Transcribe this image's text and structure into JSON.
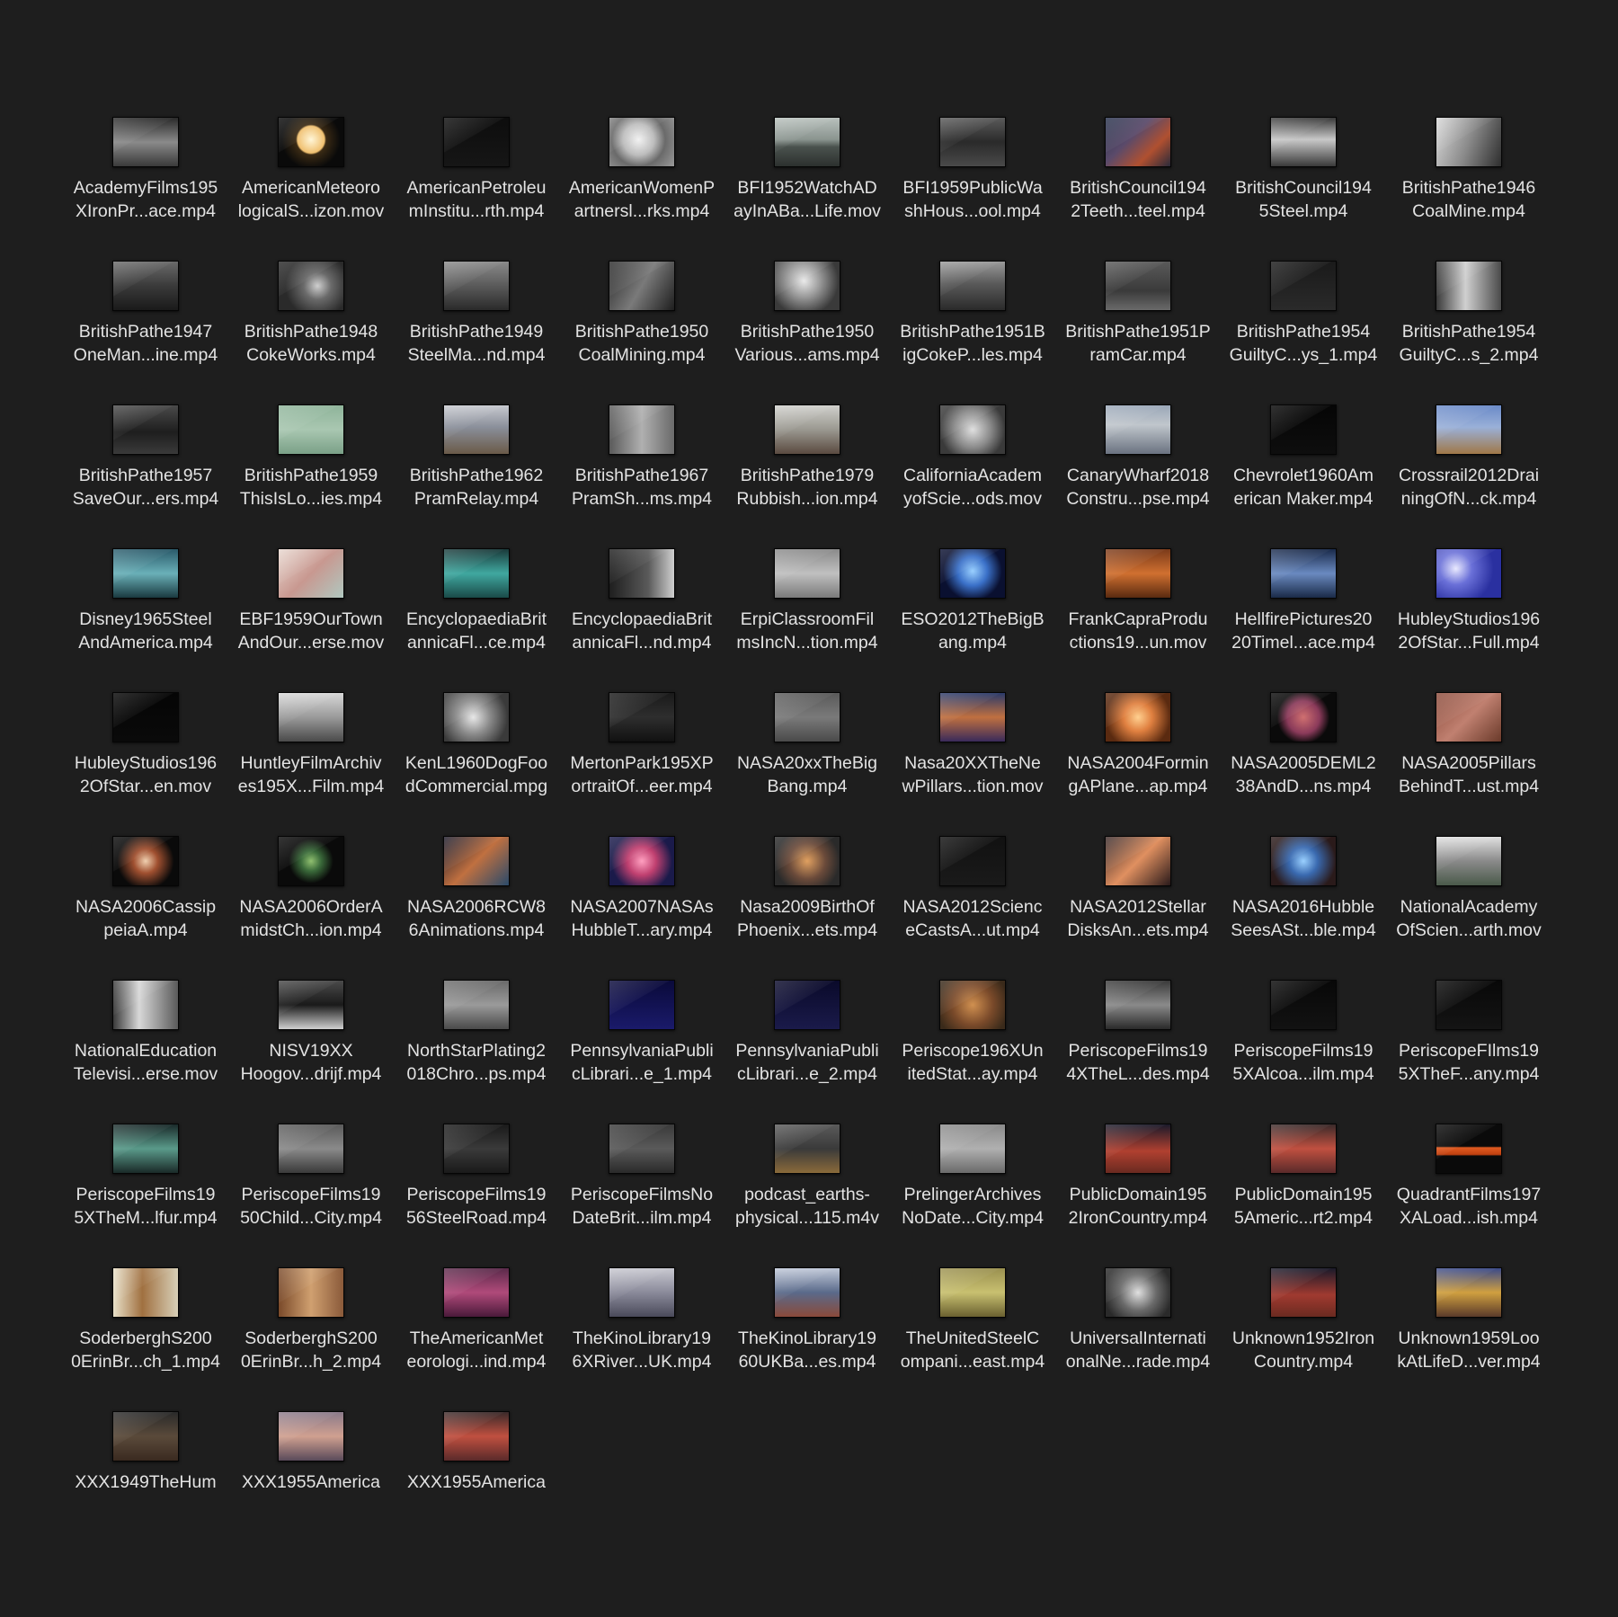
{
  "files": [
    {
      "line1": "AcademyFilms195",
      "line2": "XIronPr...ace.mp4",
      "thumb": "linear-gradient(#2a2a2a,#8a8a8a 50%,#3a3a3a)"
    },
    {
      "line1": "AmericanMeteoro",
      "line2": "logicalS...izon.mov",
      "thumb": "radial-gradient(circle at 50% 45%, #fff6d8 0%, #f0c070 32%, #3a2a14 36%, #0a0a0a 70%)"
    },
    {
      "line1": "AmericanPetroleu",
      "line2": "mInstitu...rth.mp4",
      "thumb": "linear-gradient(#0d0d0d,#161616)"
    },
    {
      "line1": "AmericanWomenP",
      "line2": "artnersl...rks.mp4",
      "thumb": "radial-gradient(circle at 45% 45%, #f2f2f2 0%, #bdbdbd 35%, #6a6a6a 60%, #9a9a9a 100%)"
    },
    {
      "line1": "BFI1952WatchAD",
      "line2": "ayInABa...Life.mov",
      "thumb": "linear-gradient(#b9c1bd 0%, #8a948f 45%, #4a524e 60%, #2c302e 100%)"
    },
    {
      "line1": "BFI1959PublicWa",
      "line2": "shHous...ool.mp4",
      "thumb": "linear-gradient(#5a5a5a,#2a2a2a 50%,#4a4a4a)"
    },
    {
      "line1": "BritishCouncil194",
      "line2": "2Teeth...teel.mp4",
      "thumb": "linear-gradient(135deg,#25304a 0%, #5a4a6a 40%, #b05030 70%, #2a2a3a 100%)"
    },
    {
      "line1": "BritishCouncil194",
      "line2": "5Steel.mp4",
      "thumb": "linear-gradient(#3a3a3a,#c8c8c8 45%,#3a3a3a)"
    },
    {
      "line1": "BritishPathe1946",
      "line2": "CoalMine.mp4",
      "thumb": "linear-gradient(110deg,#d8d8d8,#8a8a8a 50%,#2e2e2e)"
    },
    {
      "line1": "BritishPathe1947",
      "line2": "OneMan...ine.mp4",
      "thumb": "linear-gradient(#6a6a6a,#3a3a3a 50%,#1a1a1a)"
    },
    {
      "line1": "BritishPathe1948",
      "line2": "CokeWorks.mp4",
      "thumb": "radial-gradient(circle at 60% 50%, #cfcfcf 0%, #6a6a6a 30%, #2a2a2a 70%)"
    },
    {
      "line1": "BritishPathe1949",
      "line2": "SteelMa...nd.mp4",
      "thumb": "linear-gradient(#8a8a8a,#5a5a5a 50%,#2a2a2a)"
    },
    {
      "line1": "BritishPathe1950",
      "line2": "CoalMining.mp4",
      "thumb": "linear-gradient(120deg,#2a2a2a,#7a7a7a 50%,#1e1e1e)"
    },
    {
      "line1": "BritishPathe1950",
      "line2": "Various...ams.mp4",
      "thumb": "radial-gradient(circle at 45% 40%, #eaeaea 0%, #9a9a9a 35%, #3a3a3a 75%)"
    },
    {
      "line1": "BritishPathe1951B",
      "line2": "igCokeP...les.mp4",
      "thumb": "linear-gradient(#9a9a9a,#5a5a5a 45%,#2a2a2a)"
    },
    {
      "line1": "BritishPathe1951P",
      "line2": "ramCar.mp4",
      "thumb": "linear-gradient(#5a5a5a,#3a3a3a 60%,#6a6a6a)"
    },
    {
      "line1": "BritishPathe1954",
      "line2": "GuiltyC...ys_1.mp4",
      "thumb": "linear-gradient(#1a1a1a,#2a2a2a)"
    },
    {
      "line1": "BritishPathe1954",
      "line2": "GuiltyC...s_2.mp4",
      "thumb": "linear-gradient(90deg,#3a3a3a,#d0d0d0 45%,#4a4a4a)"
    },
    {
      "line1": "BritishPathe1957",
      "line2": "SaveOur...ers.mp4",
      "thumb": "linear-gradient(#4a4a4a,#1e1e1e 55%,#3a3a3a)"
    },
    {
      "line1": "BritishPathe1959",
      "line2": "ThisIsLo...ies.mp4",
      "thumb": "linear-gradient(#8fb49a,#a9c7b1 50%,#7aa087)"
    },
    {
      "line1": "BritishPathe1962",
      "line2": "PramRelay.mp4",
      "thumb": "linear-gradient(#c7c9cf,#8a8f9a 45%,#6a5a48)"
    },
    {
      "line1": "BritishPathe1967",
      "line2": "PramSh...ms.mp4",
      "thumb": "linear-gradient(90deg,#5a5a5a,#b0b0b0 50%,#6a6a6a)"
    },
    {
      "line1": "BritishPathe1979",
      "line2": "Rubbish...ion.mp4",
      "thumb": "linear-gradient(#d0d0cc,#9a9890 50%,#5a4a40)"
    },
    {
      "line1": "CaliforniaAcadem",
      "line2": "yofScie...ods.mov",
      "thumb": "radial-gradient(circle at 50% 50%, #e0e0e0 0%, #8a8a8a 45%, #3a3a3a 80%)"
    },
    {
      "line1": "CanaryWharf2018",
      "line2": "Constru...pse.mp4",
      "thumb": "linear-gradient(#9aa7b8,#c0c6cc 40%,#6a7280)"
    },
    {
      "line1": "Chevrolet1960Am",
      "line2": "erican Maker.mp4",
      "thumb": "linear-gradient(#050505,#0e0e0e)"
    },
    {
      "line1": "Crossrail2012Drai",
      "line2": "ningOfN...ck.mp4",
      "thumb": "linear-gradient(#6a8ac8,#9ab0d8 45%,#a07848)"
    },
    {
      "line1": "Disney1965Steel",
      "line2": "AndAmerica.mp4",
      "thumb": "linear-gradient(#2a5a6a,#6ab0b8 50%,#1a3a40)"
    },
    {
      "line1": "EBF1959OurTown",
      "line2": "AndOur...erse.mov",
      "thumb": "linear-gradient(135deg,#e8d8d0,#c89890 50%,#b0c8c0)"
    },
    {
      "line1": "EncyclopaediaBrit",
      "line2": "annicaFl...ce.mp4",
      "thumb": "linear-gradient(#1a3a3a,#40a8a0 50%,#1a4a48)"
    },
    {
      "line1": "EncyclopaediaBrit",
      "line2": "annicaFl...nd.mp4",
      "thumb": "linear-gradient(90deg,#1e1e1e,#5a5a5a 60%,#cfcfcf)"
    },
    {
      "line1": "ErpiClassroomFil",
      "line2": "msIncN...tion.mp4",
      "thumb": "linear-gradient(#8a8a8a,#c0c0c0 50%,#7a7a7a)"
    },
    {
      "line1": "ESO2012TheBigB",
      "line2": "ang.mp4",
      "thumb": "radial-gradient(circle at 50% 45%, #9ad0ff 0%, #3a70c8 35%, #0a1030 70%)"
    },
    {
      "line1": "FrankCapraProdu",
      "line2": "ctions19...un.mov",
      "thumb": "linear-gradient(#7a3a1a,#d07030 50%,#5a2a10)"
    },
    {
      "line1": "HellfirePictures20",
      "line2": "20Timel...ace.mp4",
      "thumb": "linear-gradient(#1a2a4a,#6a8ac0 50%,#1a2a48)"
    },
    {
      "line1": "HubleyStudios196",
      "line2": "2OfStar...Full.mp4",
      "thumb": "radial-gradient(circle at 30% 40%, #e8e8ff 0%, #6a70d8 30%, #2a30a0 70%)"
    },
    {
      "line1": "HubleyStudios196",
      "line2": "2OfStar...en.mov",
      "thumb": "linear-gradient(#050505,#0a0a0a)"
    },
    {
      "line1": "HuntleyFilmArchiv",
      "line2": "es195X...Film.mp4",
      "thumb": "linear-gradient(#d8d8d8,#9a9a9a 50%,#4a4a4a)"
    },
    {
      "line1": "KenL1960DogFoo",
      "line2": "dCommercial.mpg",
      "thumb": "radial-gradient(circle at 45% 50%, #e8e8e8 0%, #8a8a8a 40%, #3a3a3a 80%)"
    },
    {
      "line1": "MertonPark195XP",
      "line2": "ortraitOf...eer.mp4",
      "thumb": "linear-gradient(#1a1a1a,#2e2e2e 50%,#111)"
    },
    {
      "line1": "NASA20xxTheBig",
      "line2": "Bang.mp4",
      "thumb": "linear-gradient(#5a5a5a,#7a7a7a 50%,#4a4a4a)"
    },
    {
      "line1": "Nasa20XXTheNe",
      "line2": "wPillars...tion.mov",
      "thumb": "linear-gradient(#2a3a6a,#c07040 50%,#3a2a5a)"
    },
    {
      "line1": "NASA2004Formin",
      "line2": "gAPlane...ap.mp4",
      "thumb": "radial-gradient(circle at 50% 50%, #ffd090 0%, #e08040 35%, #5a2a10 80%)"
    },
    {
      "line1": "NASA2005DEML2",
      "line2": "38AndD...ns.mp4",
      "thumb": "radial-gradient(circle at 50% 50%, #d07070 0%, #8a3a5a 40%, #0a0a0a 65%)"
    },
    {
      "line1": "NASA2005Pillars",
      "line2": "BehindT...ust.mp4",
      "thumb": "linear-gradient(135deg,#8a4a3a,#c08070 50%,#6a3a2a)"
    },
    {
      "line1": "NASA2006Cassip",
      "line2": "peiaA.mp4",
      "thumb": "radial-gradient(circle at 50% 50%, #f0d0b0 0%, #a05030 30%, #0a0a0a 70%)"
    },
    {
      "line1": "NASA2006OrderA",
      "line2": "midstCh...ion.mp4",
      "thumb": "radial-gradient(circle at 50% 50%, #90c070 0%, #3a6a3a 25%, #0a0a0a 55%)"
    },
    {
      "line1": "NASA2006RCW8",
      "line2": "6Animations.mp4",
      "thumb": "linear-gradient(135deg,#1a1a2a,#c07040 50%,#2a4a6a)"
    },
    {
      "line1": "NASA2007NASAs",
      "line2": "HubbleT...ary.mp4",
      "thumb": "radial-gradient(circle at 50% 50%, #ffa0c0 0%, #c04070 35%, #1a1a4a 75%)"
    },
    {
      "line1": "Nasa2009BirthOf",
      "line2": "Phoenix...ets.mp4",
      "thumb": "radial-gradient(circle at 50% 50%, #e0a060 0%, #6a4a3a 45%, #2a2a2a 80%)"
    },
    {
      "line1": "NASA2012Scienc",
      "line2": "eCastsA...ut.mp4",
      "thumb": "linear-gradient(#111,#1a1a1a)"
    },
    {
      "line1": "NASA2012Stellar",
      "line2": "DisksAn...ets.mp4",
      "thumb": "linear-gradient(135deg,#3a2a2a,#e09060 50%,#2a1a1a)"
    },
    {
      "line1": "NASA2016Hubble",
      "line2": "SeesASt...ble.mp4",
      "thumb": "radial-gradient(circle at 50% 50%, #9ad0ff 0%, #3a6ab0 35%, #2a1a1a 80%)"
    },
    {
      "line1": "NationalAcademy",
      "line2": "OfScien...arth.mov",
      "thumb": "linear-gradient(#e0e0e0,#8a8a8a 50%,#4a5a4a)"
    },
    {
      "line1": "NationalEducation",
      "line2": "Televisi...erse.mov",
      "thumb": "linear-gradient(90deg,#3a3a3a,#d8d8d8 40%,#5a5a5a)"
    },
    {
      "line1": "NISV19XX",
      "line2": "Hoogov...drijf.mp4",
      "thumb": "linear-gradient(#4a4a4a,#1a1a1a 50%,#d0d0d0)"
    },
    {
      "line1": "NorthStarPlating2",
      "line2": "018Chro...ps.mp4",
      "thumb": "linear-gradient(#6a6a6a,#9a9a9a 50%,#4a4a4a)"
    },
    {
      "line1": "PennsylvaniaPubli",
      "line2": "cLibrari...e_1.mp4",
      "thumb": "linear-gradient(#0a0a3a,#1a1a6a)"
    },
    {
      "line1": "PennsylvaniaPubli",
      "line2": "cLibrari...e_2.mp4",
      "thumb": "linear-gradient(#0a0a2a,#1a1a4a)"
    },
    {
      "line1": "Periscope196XUn",
      "line2": "itedStat...ay.mp4",
      "thumb": "radial-gradient(circle at 50% 50%, #d09050 0%, #7a4a2a 50%, #3a2a1a 90%)"
    },
    {
      "line1": "PeriscopeFilms19",
      "line2": "4XTheL...des.mp4",
      "thumb": "linear-gradient(#3a3a3a,#8a8a8a 50%,#2a2a2a)"
    },
    {
      "line1": "PeriscopeFilms19",
      "line2": "5XAlcoa...ilm.mp4",
      "thumb": "linear-gradient(#080808,#121212)"
    },
    {
      "line1": "PeriscopeFIlms19",
      "line2": "5XTheF...any.mp4",
      "thumb": "linear-gradient(#080808,#141414)"
    },
    {
      "line1": "PeriscopeFilms19",
      "line2": "5XTheM...lfur.mp4",
      "thumb": "linear-gradient(#1a2a2a,#5a9a8a 50%,#1a2a28)"
    },
    {
      "line1": "PeriscopeFilms19",
      "line2": "50Child...City.mp4",
      "thumb": "linear-gradient(#5a5a5a,#8a8a8a 50%,#3a3a3a)"
    },
    {
      "line1": "PeriscopeFilms19",
      "line2": "56SteelRoad.mp4",
      "thumb": "linear-gradient(#1a1a1a,#3a3a3a 50%,#1a1a1a)"
    },
    {
      "line1": "PeriscopeFilmsNo",
      "line2": "DateBrit...ilm.mp4",
      "thumb": "linear-gradient(#3a3a3a,#5a5a5a 50%,#2a2a2a)"
    },
    {
      "line1": "podcast_earths-",
      "line2": "physical...115.m4v",
      "thumb": "linear-gradient(#5a5a5a,#3a3a3a 50%,#8a6a3a)"
    },
    {
      "line1": "PrelingerArchives",
      "line2": "NoDate...City.mp4",
      "thumb": "linear-gradient(#8a8a8a,#b0b0b0 50%,#6a6a6a)"
    },
    {
      "line1": "PublicDomain195",
      "line2": "2IronCountry.mp4",
      "thumb": "linear-gradient(#1a1a2a,#b04030 55%,#6a2a20)"
    },
    {
      "line1": "PublicDomain195",
      "line2": "5Americ...rt2.mp4",
      "thumb": "linear-gradient(#3a2a2a,#c05040 50%,#5a2a2a)"
    },
    {
      "line1": "QuadrantFilms197",
      "line2": "XALoad...ish.mp4",
      "thumb": "linear-gradient(#0a0a0a 0%, #0a0a0a 45%, #e05a20 48%, #c04010 62%, #0a0a0a 65%, #0a0a0a 100%)"
    },
    {
      "line1": "SoderberghS200",
      "line2": "0ErinBr...ch_1.mp4",
      "thumb": "linear-gradient(90deg,#e8e0c8,#a07040 45%,#d8d0b8)"
    },
    {
      "line1": "SoderberghS200",
      "line2": "0ErinBr...h_2.mp4",
      "thumb": "linear-gradient(90deg,#7a4a2a,#d0a070 50%,#8a5a3a)"
    },
    {
      "line1": "TheAmericanMet",
      "line2": "eorologi...ind.mp4",
      "thumb": "linear-gradient(#5a2a4a,#b04a7a 50%,#4a1a3a)"
    },
    {
      "line1": "TheKinoLibrary19",
      "line2": "6XRiver...UK.mp4",
      "thumb": "linear-gradient(#c8c8d0,#8a8a9a 50%,#4a4a5a)"
    },
    {
      "line1": "TheKinoLibrary19",
      "line2": "60UKBa...es.mp4",
      "thumb": "linear-gradient(#c0c8d8,#5a6a8a 50%,#8a4a3a)"
    },
    {
      "line1": "TheUnitedSteelC",
      "line2": "ompani...east.mp4",
      "thumb": "linear-gradient(#9a9050,#c8c070 50%,#6a6030)"
    },
    {
      "line1": "UniversalInternati",
      "line2": "onalNe...rade.mp4",
      "thumb": "radial-gradient(circle at 50% 50%, #e0e0e0 0%, #6a6a6a 45%, #2a2a2a 85%)"
    },
    {
      "line1": "Unknown1952Iron",
      "line2": "Country.mp4",
      "thumb": "linear-gradient(#1a1a2a,#a03a30 55%,#6a2a20)"
    },
    {
      "line1": "Unknown1959Loo",
      "line2": "kAtLifeD...ver.mp4",
      "thumb": "linear-gradient(#3a4a8a,#d0a040 50%,#5a3a2a)"
    },
    {
      "line1": "XXX1949TheHum",
      "line2": "",
      "thumb": "linear-gradient(#2a2a2a,#5a4a3a 50%,#3a2a20)"
    },
    {
      "line1": "XXX1955America",
      "line2": "",
      "thumb": "linear-gradient(#8a7a8a,#d0a090 50%,#5a4a5a)"
    },
    {
      "line1": "XXX1955America",
      "line2": "",
      "thumb": "linear-gradient(#3a2a2a,#c05040 50%,#5a2a2a)"
    }
  ]
}
